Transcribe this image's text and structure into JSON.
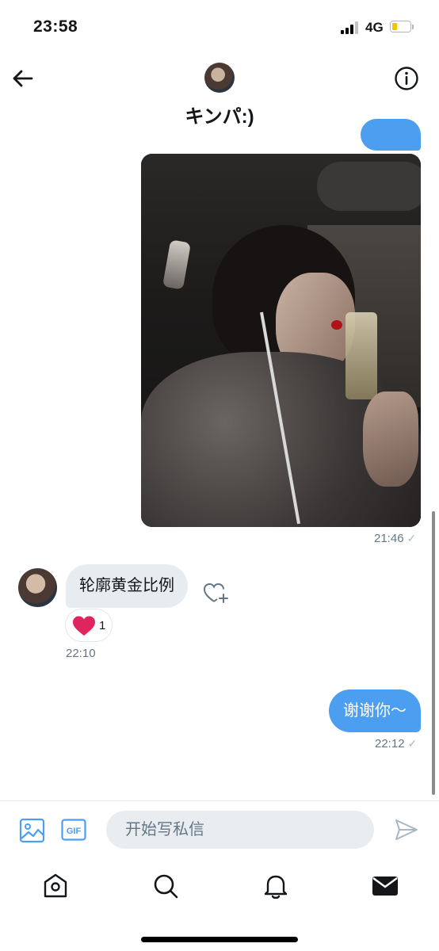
{
  "status_bar": {
    "time": "23:58",
    "network": "4G",
    "battery_level": 0.2
  },
  "header": {
    "back_icon": "arrow-left-icon",
    "title": "キンパ:)",
    "info_icon": "info-icon"
  },
  "conversation": {
    "photo_message": {
      "time": "21:46",
      "read_icon": "check-icon"
    },
    "received_message": {
      "text": "轮廓黄金比例",
      "time": "22:10",
      "reaction_emoji_icon": "heart-icon",
      "reaction_count": "1",
      "add_reaction_icon": "heart-plus-icon"
    },
    "sent_message": {
      "text": "谢谢你～",
      "time": "22:12",
      "read_icon": "check-icon"
    }
  },
  "composer": {
    "placeholder": "开始写私信",
    "image_icon": "image-icon",
    "gif_label": "GIF",
    "send_icon": "send-icon"
  },
  "tabbar": {
    "items": [
      "home-icon",
      "search-icon",
      "notifications-icon",
      "messages-icon"
    ]
  },
  "colors": {
    "accent": "#4c9ef0",
    "received_bubble": "#e6ecf0",
    "heart": "#e0245e"
  }
}
